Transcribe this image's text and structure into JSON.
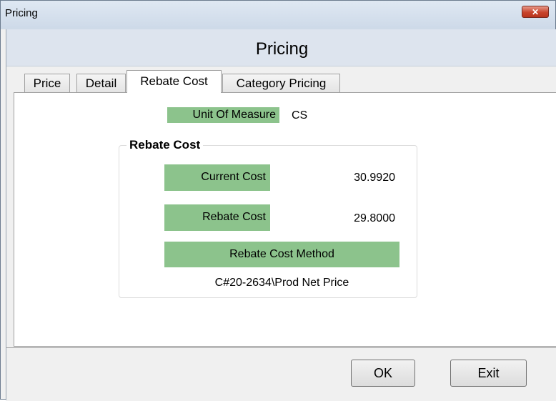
{
  "window": {
    "title": "Pricing",
    "close_glyph": "✕"
  },
  "header": {
    "title": "Pricing"
  },
  "tabs": [
    {
      "label": "Price",
      "active": false
    },
    {
      "label": "Detail",
      "active": false
    },
    {
      "label": "Rebate Cost",
      "active": true
    },
    {
      "label": "Category Pricing",
      "active": false
    }
  ],
  "unit_of_measure": {
    "label": "Unit Of Measure",
    "value": "CS"
  },
  "rebate_group": {
    "title": "Rebate Cost",
    "current_cost": {
      "label": "Current Cost",
      "value": "30.9920"
    },
    "rebate_cost": {
      "label": "Rebate Cost",
      "value": "29.8000"
    },
    "method": {
      "label": "Rebate Cost Method",
      "value": "C#20-2634\\Prod Net Price"
    }
  },
  "buttons": {
    "ok": "OK",
    "exit": "Exit"
  },
  "colors": {
    "label_green": "#8cc38c",
    "header_band": "#dde4ee",
    "close_red": "#c8442d"
  }
}
